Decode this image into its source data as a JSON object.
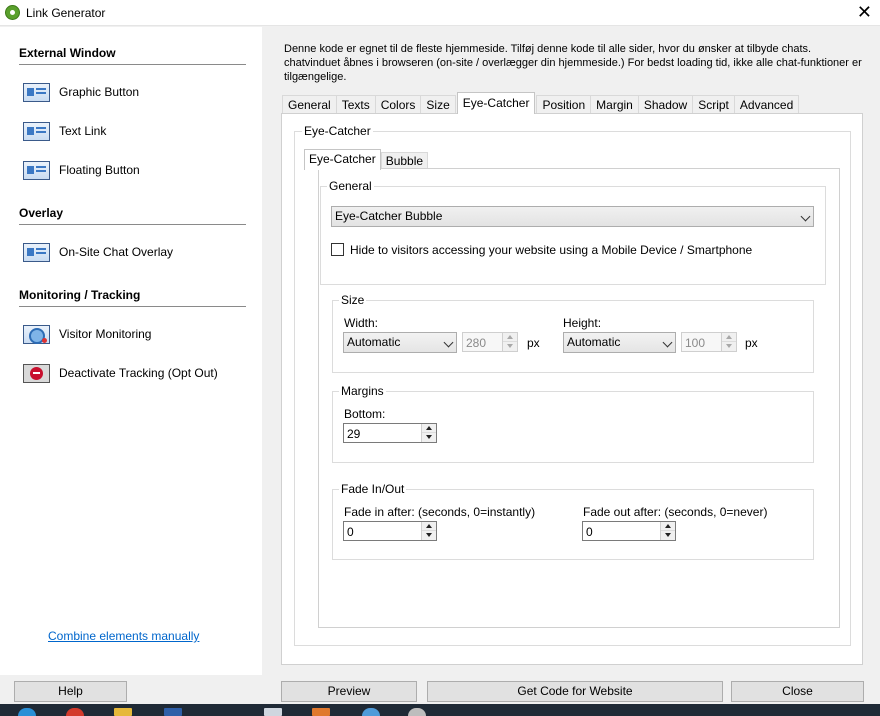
{
  "window": {
    "title": "Link Generator",
    "close_glyph": "✕"
  },
  "sidebar": {
    "sections": [
      {
        "heading": "External Window",
        "items": [
          {
            "label": "Graphic Button",
            "icon": "graphic-button-icon"
          },
          {
            "label": "Text Link",
            "icon": "text-link-icon"
          },
          {
            "label": "Floating Button",
            "icon": "floating-button-icon"
          }
        ]
      },
      {
        "heading": "Overlay",
        "items": [
          {
            "label": "On-Site Chat Overlay",
            "icon": "chat-overlay-icon"
          }
        ]
      },
      {
        "heading": "Monitoring / Tracking",
        "items": [
          {
            "label": "Visitor Monitoring",
            "icon": "visitor-monitoring-icon"
          },
          {
            "label": "Deactivate Tracking (Opt Out)",
            "icon": "deactivate-tracking-icon"
          }
        ]
      }
    ],
    "combine_link": "Combine elements manually"
  },
  "description": "Denne kode er egnet til de fleste hjemmeside. Tilføj denne kode til alle sider, hvor du ønsker at tilbyde chats. chatvinduet åbnes i browseren (on-site / overlægger din hjemmeside.) For bedst loading tid, ikke alle chat-funktioner er tilgængelige.",
  "tabs": [
    "General",
    "Texts",
    "Colors",
    "Size",
    "Eye-Catcher",
    "Position",
    "Margin",
    "Shadow",
    "Script",
    "Advanced"
  ],
  "active_tab": "Eye-Catcher",
  "eye_catcher": {
    "group_label": "Eye-Catcher",
    "subtabs": [
      "Eye-Catcher",
      "Bubble"
    ],
    "active_subtab": "Eye-Catcher",
    "general": {
      "label": "General",
      "type_value": "Eye-Catcher Bubble",
      "hide_mobile_label": "Hide to visitors accessing your website using a Mobile Device / Smartphone",
      "hide_mobile_checked": false
    },
    "size": {
      "label": "Size",
      "width_label": "Width:",
      "width_mode": "Automatic",
      "width_value": "280",
      "height_label": "Height:",
      "height_mode": "Automatic",
      "height_value": "100",
      "unit": "px"
    },
    "margins": {
      "label": "Margins",
      "bottom_label": "Bottom:",
      "bottom_value": "29"
    },
    "fade": {
      "label": "Fade In/Out",
      "fade_in_label": "Fade in after: (seconds, 0=instantly)",
      "fade_in_value": "0",
      "fade_out_label": "Fade out after: (seconds, 0=never)",
      "fade_out_value": "0"
    }
  },
  "footer": {
    "help": "Help",
    "preview": "Preview",
    "get_code": "Get Code for Website",
    "close": "Close"
  }
}
